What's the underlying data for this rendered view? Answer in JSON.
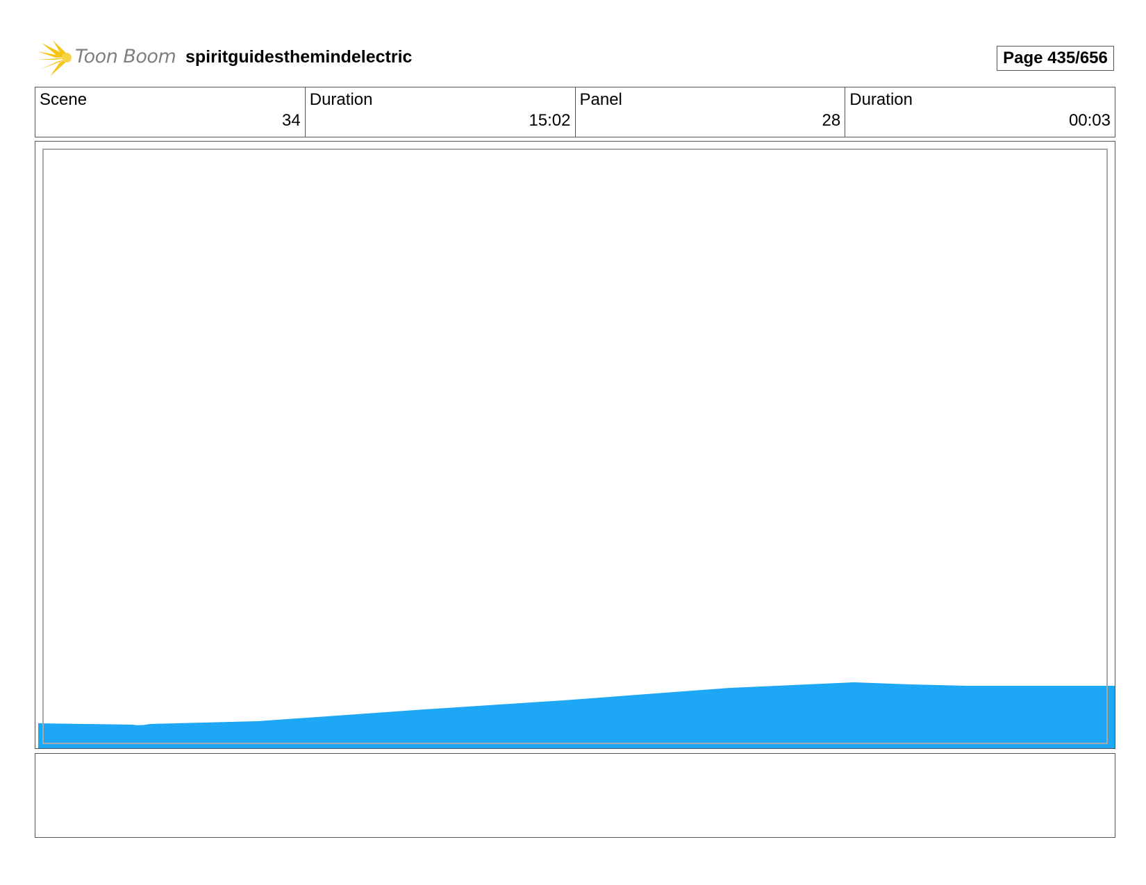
{
  "header": {
    "brand": "Toon Boom",
    "project_name": "spiritguidesthemindelectric",
    "page_indicator": "Page 435/656"
  },
  "info": {
    "scene_label": "Scene",
    "scene_value": "34",
    "scene_duration_label": "Duration",
    "scene_duration_value": "15:02",
    "panel_label": "Panel",
    "panel_value": "28",
    "panel_duration_label": "Duration",
    "panel_duration_value": "00:03"
  },
  "colors": {
    "logo_star": "#f5c518",
    "water_fill": "#1ea7f5",
    "frame_border": "#a8a8a8"
  },
  "notes": {
    "text": ""
  }
}
